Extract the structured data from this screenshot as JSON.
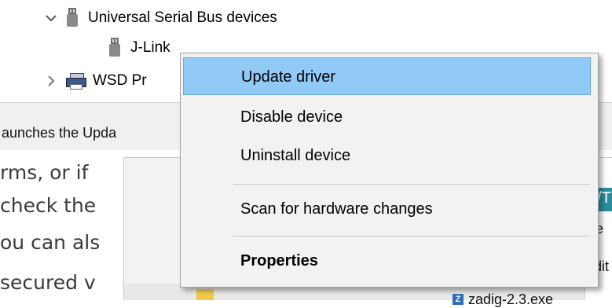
{
  "tree": {
    "category_label": "Universal Serial Bus devices",
    "child_label": "J-Link",
    "next_label": "WSD Pr"
  },
  "statusbar": {
    "text": "aunches the Upda"
  },
  "background": {
    "lines": [
      "rms, or if",
      "check the",
      "ou can als",
      "secured v"
    ],
    "right_labels": [
      "/T",
      "e",
      "dit"
    ],
    "file_label": "zadig-2.3.exe"
  },
  "context_menu": {
    "items": [
      {
        "label": "Update driver"
      },
      {
        "label": "Disable device"
      },
      {
        "label": "Uninstall device"
      },
      {
        "label": "Scan for hardware changes"
      },
      {
        "label": "Properties"
      }
    ]
  },
  "colors": {
    "highlight": "#91c9f7",
    "menu_background": "#f2f2f2"
  }
}
